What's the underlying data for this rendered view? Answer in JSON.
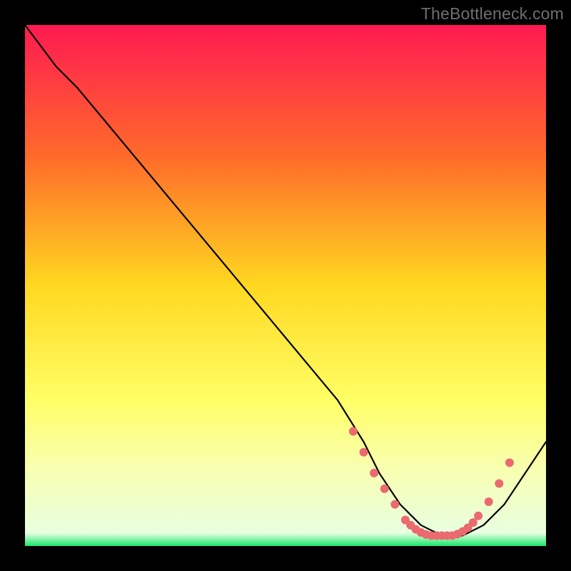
{
  "watermark": "TheBottleneck.com",
  "chart_data": {
    "type": "line",
    "title": "",
    "xlabel": "",
    "ylabel": "",
    "xlim": [
      0,
      100
    ],
    "ylim": [
      0,
      100
    ],
    "gradient_stops": [
      {
        "offset": 0,
        "color": "#ff1a52"
      },
      {
        "offset": 0.25,
        "color": "#ff6a2a"
      },
      {
        "offset": 0.5,
        "color": "#ffd820"
      },
      {
        "offset": 0.72,
        "color": "#ffff66"
      },
      {
        "offset": 0.85,
        "color": "#f8ffb0"
      },
      {
        "offset": 0.975,
        "color": "#e8ffe0"
      },
      {
        "offset": 1.0,
        "color": "#17e86a"
      }
    ],
    "series": [
      {
        "name": "curve",
        "stroke": "#000000",
        "stroke_width": 2.2,
        "x": [
          0,
          6,
          10,
          20,
          30,
          40,
          50,
          60,
          65,
          68,
          72,
          76,
          80,
          84,
          88,
          92,
          100
        ],
        "y": [
          100,
          92,
          88,
          76,
          64,
          52,
          40,
          28,
          20,
          14,
          8,
          4,
          2,
          2,
          4,
          8,
          20
        ]
      }
    ],
    "markers": {
      "color": "#ea6a6f",
      "radius": 6,
      "x": [
        63,
        65,
        67,
        69,
        71,
        73,
        74,
        75,
        76,
        77,
        78,
        79,
        80,
        81,
        82,
        83,
        84,
        85,
        86,
        87,
        89,
        91,
        93
      ],
      "y": [
        22,
        18,
        14,
        11,
        8,
        5,
        4,
        3.2,
        2.6,
        2.2,
        2,
        2,
        2,
        2,
        2,
        2.3,
        2.8,
        3.5,
        4.5,
        5.8,
        8.5,
        12,
        16
      ]
    }
  }
}
